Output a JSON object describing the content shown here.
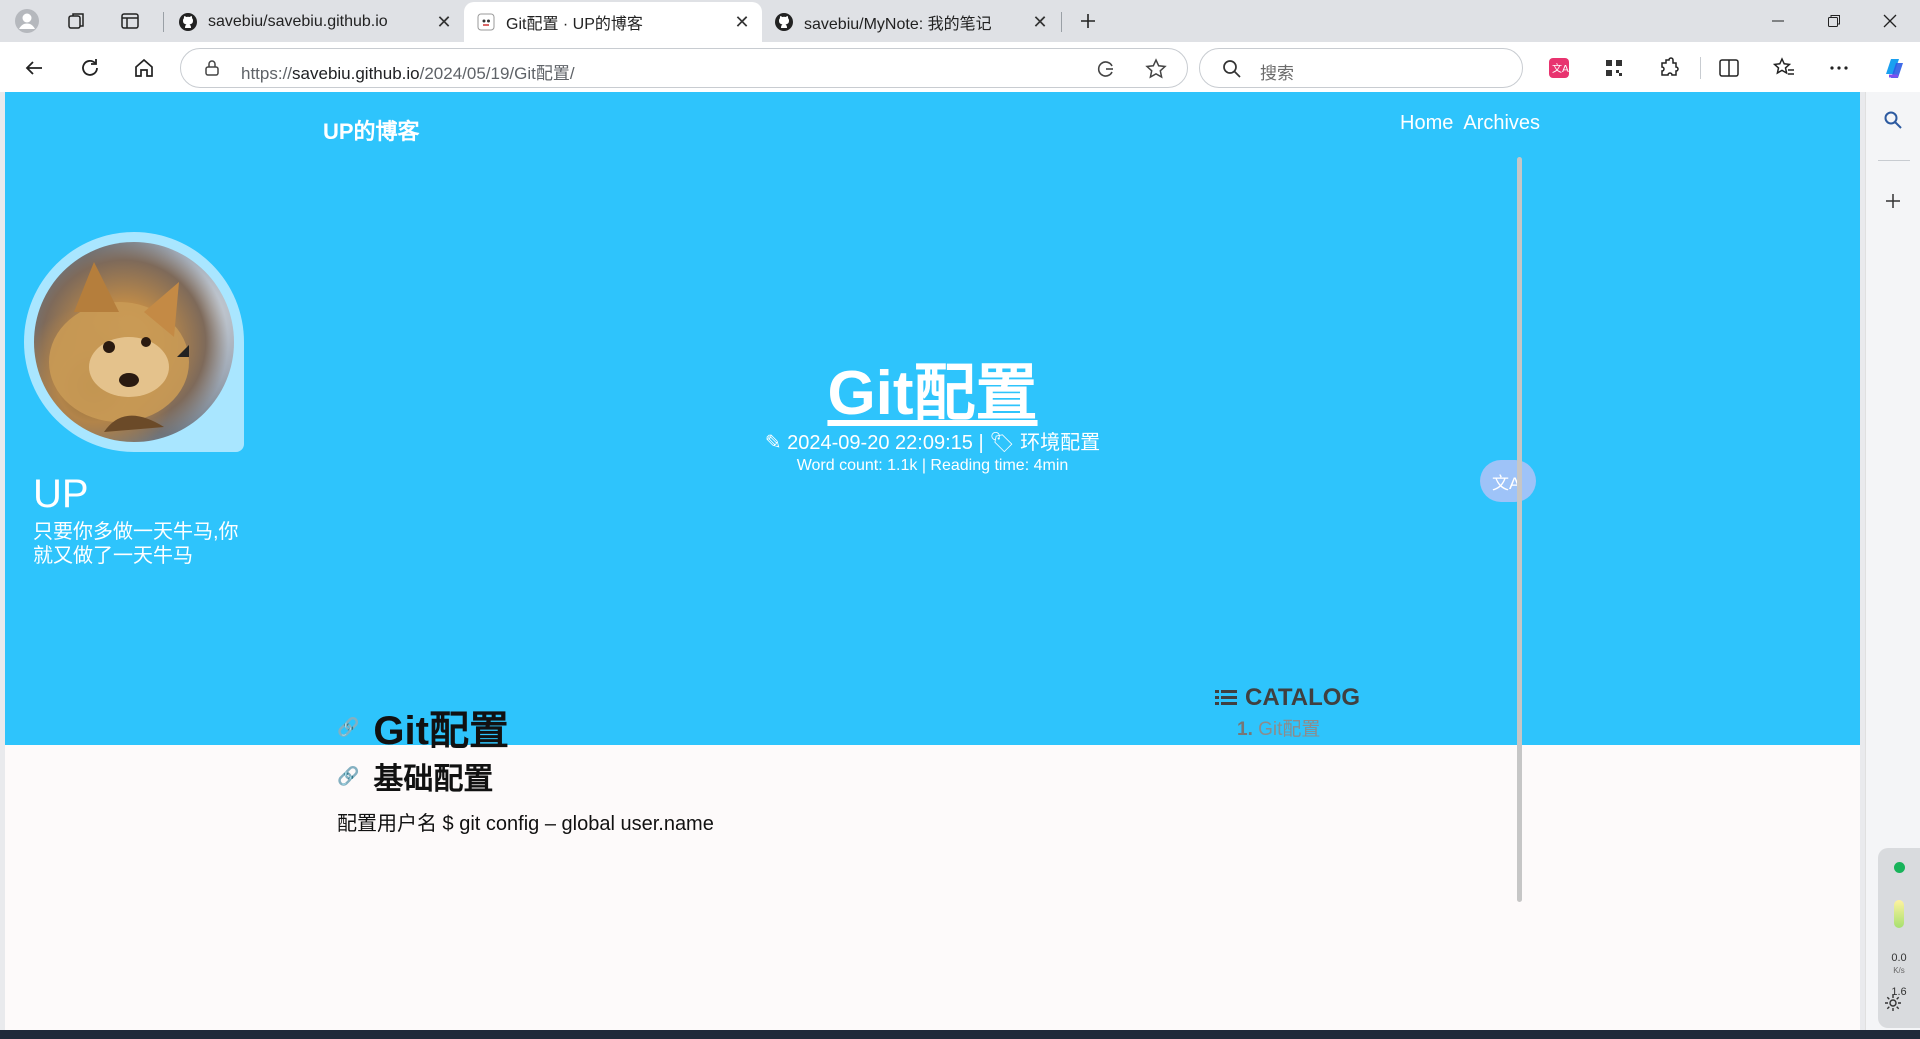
{
  "tabs": [
    {
      "title": "savebiu/savebiu.github.io",
      "active": false,
      "favicon": "github-icon"
    },
    {
      "title": "Git配置 · UP的博客",
      "active": true,
      "favicon": "site-icon"
    },
    {
      "title": "savebiu/MyNote: 我的笔记",
      "active": false,
      "favicon": "github-icon"
    }
  ],
  "address": {
    "prefix": "https://",
    "host": "savebiu.github.io",
    "path": "/2024/05/19/Git配置/"
  },
  "search": {
    "placeholder": "搜索"
  },
  "site": {
    "brand": "UP的博客",
    "nav": [
      "Home",
      "Archives"
    ],
    "profile": {
      "name": "UP",
      "bio": "只要你多做一天牛马,你就又做了一天牛马"
    }
  },
  "post": {
    "title": "Git配置",
    "date": "2024-09-20 22:09:15",
    "tag": "环境配置",
    "stats": "Word count: 1.1k | Reading time: 4min",
    "h1": "Git配置",
    "h2": "基础配置",
    "paragraph": "配置用户名 $ git config – global user.name"
  },
  "catalog": {
    "heading": "CATALOG",
    "items": [
      {
        "num": "1.",
        "label": "Git配置"
      }
    ]
  },
  "widget": {
    "speed_up": "0.0",
    "speed_unit": "K/s",
    "speed_down": "1.6"
  },
  "colors": {
    "hero": "#2ec4fc",
    "accent_translate": "#9ec3f8"
  }
}
